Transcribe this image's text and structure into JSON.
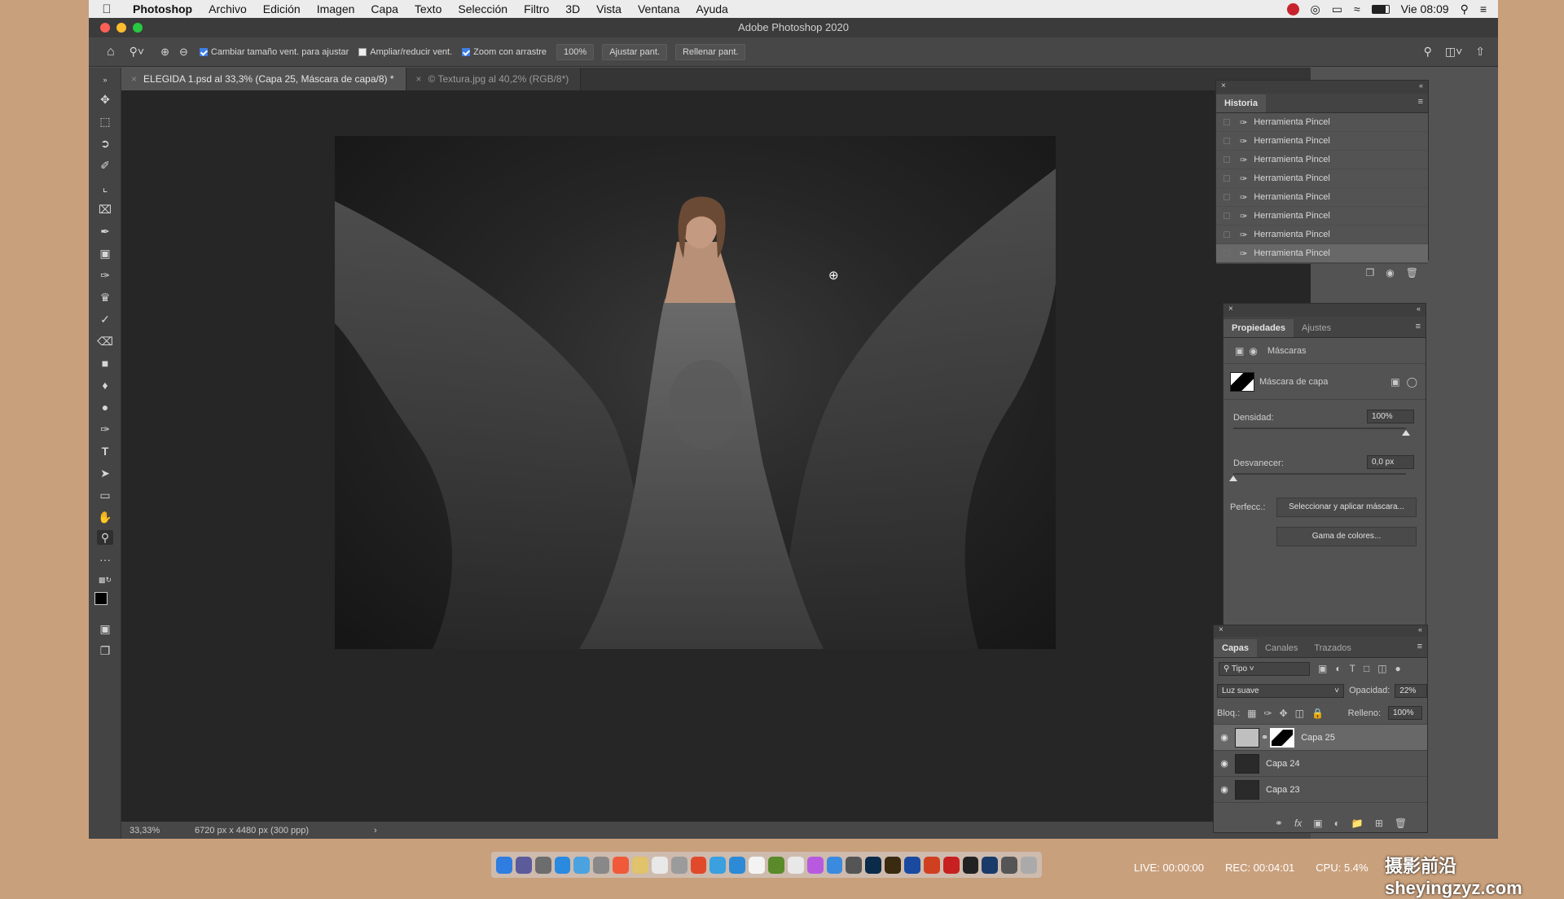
{
  "menubar": {
    "items": [
      "Photoshop",
      "Archivo",
      "Edición",
      "Imagen",
      "Capa",
      "Texto",
      "Selección",
      "Filtro",
      "3D",
      "Vista",
      "Ventana",
      "Ayuda"
    ],
    "clock": "Vie 08:09"
  },
  "window": {
    "title": "Adobe Photoshop 2020"
  },
  "options": {
    "chk_resize": "Cambiar tamaño vent. para ajustar",
    "chk_zoom_all": "Ampliar/reducir vent.",
    "chk_scrubby": "Zoom con arrastre",
    "zoom_value": "100%",
    "btn_fit": "Ajustar pant.",
    "btn_fill": "Rellenar pant."
  },
  "tabs": [
    {
      "label": "ELEGIDA 1.psd al 33,3% (Capa 25, Máscara de capa/8) *",
      "active": true
    },
    {
      "label": "© Textura.jpg al 40,2% (RGB/8*)",
      "active": false
    }
  ],
  "status": {
    "zoom": "33,33%",
    "doc_info": "6720 px x 4480 px (300 ppp)"
  },
  "history": {
    "title": "Historia",
    "items": [
      "Herramienta Pincel",
      "Herramienta Pincel",
      "Herramienta Pincel",
      "Herramienta Pincel",
      "Herramienta Pincel",
      "Herramienta Pincel",
      "Herramienta Pincel",
      "Herramienta Pincel"
    ]
  },
  "properties": {
    "tab_props": "Propiedades",
    "tab_adjust": "Ajustes",
    "masks_label": "Máscaras",
    "layer_mask": "Máscara de capa",
    "density_label": "Densidad:",
    "density_value": "100%",
    "density_level": 1.0,
    "feather_label": "Desvanecer:",
    "feather_value": "0,0 px",
    "feather_level": 0.0,
    "refine_label": "Perfecc.:",
    "btn_select_mask": "Seleccionar y aplicar máscara...",
    "btn_color_range": "Gama de colores..."
  },
  "layers": {
    "tab_layers": "Capas",
    "tab_channels": "Canales",
    "tab_paths": "Trazados",
    "filter": "Tipo",
    "blend": "Luz suave",
    "opacity_label": "Opacidad:",
    "opacity": "22%",
    "lock_label": "Bloq.:",
    "fill_label": "Relleno:",
    "fill": "100%",
    "rows": [
      {
        "name": "Capa 25",
        "selected": true
      },
      {
        "name": "Capa 24",
        "selected": false
      },
      {
        "name": "Capa 23",
        "selected": false
      }
    ]
  },
  "bottom": {
    "live": "LIVE: 00:00:00",
    "rec": "REC: 00:04:01",
    "cpu": "CPU: 5.4%"
  },
  "watermark": "摄影前沿sheyingzyz.com",
  "colors": {
    "accent": "#3d7ee4",
    "panel": "#535353",
    "canvas": "#262626"
  }
}
